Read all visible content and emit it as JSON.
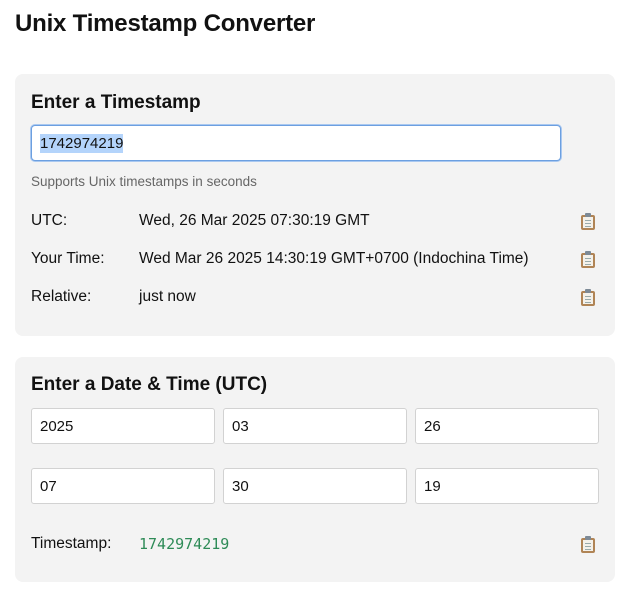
{
  "page": {
    "title": "Unix Timestamp Converter"
  },
  "timestamp_section": {
    "title": "Enter a Timestamp",
    "input_value": "1742974219",
    "hint": "Supports Unix timestamps in seconds",
    "rows": [
      {
        "label": "UTC:",
        "value": "Wed, 26 Mar 2025 07:30:19 GMT"
      },
      {
        "label": "Your Time:",
        "value": "Wed Mar 26 2025 14:30:19 GMT+0700 (Indochina Time)"
      },
      {
        "label": "Relative:",
        "value": "just now"
      }
    ]
  },
  "datetime_section": {
    "title": "Enter a Date & Time (UTC)",
    "year": "2025",
    "month": "03",
    "day": "26",
    "hour": "07",
    "minute": "30",
    "second": "19",
    "result_label": "Timestamp:",
    "result_value": "1742974219"
  },
  "icons": {
    "copy": "clipboard-icon"
  },
  "colors": {
    "timestamp_result": "#2e8b57",
    "selection": "#b4d4fb",
    "focus_border": "#6c9fe0"
  }
}
